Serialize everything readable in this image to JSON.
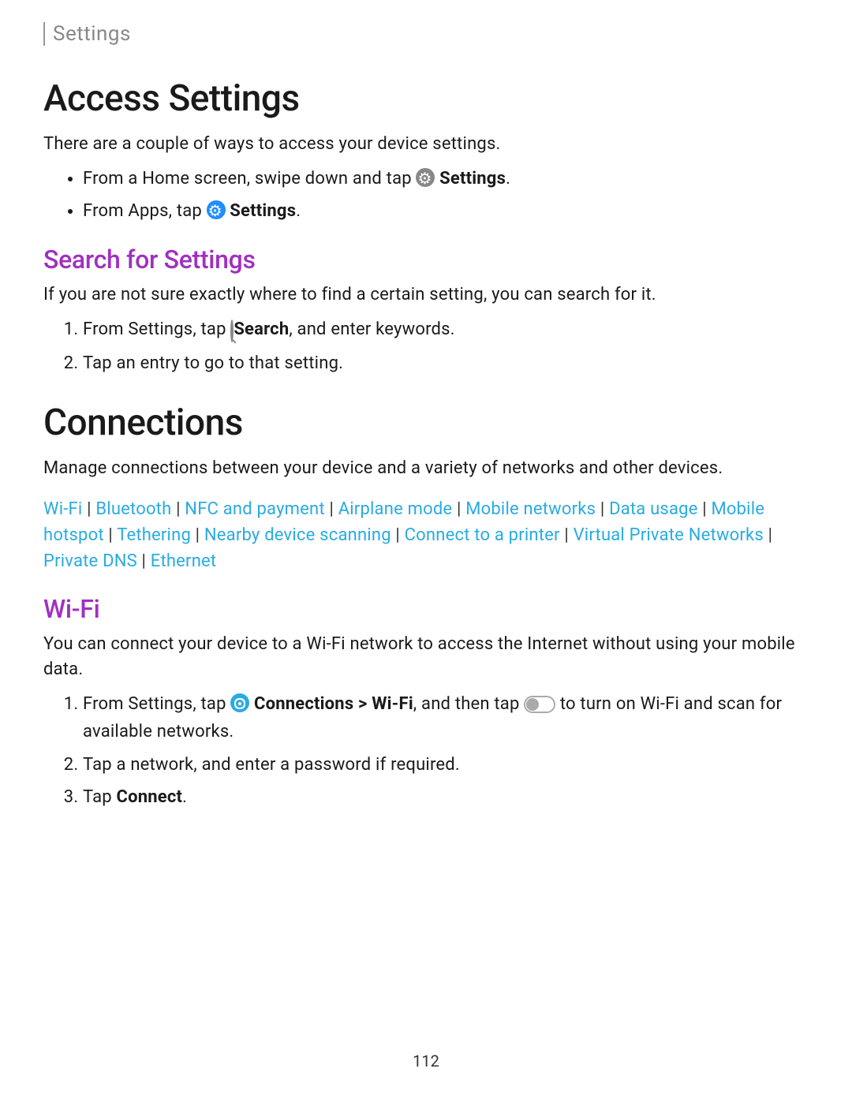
{
  "breadcrumb": "Settings",
  "section1": {
    "title": "Access Settings",
    "intro": "There are a couple of ways to access your device settings.",
    "bullets": {
      "b1_pre": "From a Home screen, swipe down and tap ",
      "b1_bold": "Settings",
      "b1_post": ".",
      "b2_pre": "From Apps, tap ",
      "b2_bold": "Settings",
      "b2_post": "."
    }
  },
  "section2": {
    "title": "Search for Settings",
    "intro": "If you are not sure exactly where to find a certain setting, you can search for it.",
    "steps": {
      "s1_pre": "From Settings, tap ",
      "s1_bold": "Search",
      "s1_post": ", and enter keywords.",
      "s2": "Tap an entry to go to that setting."
    }
  },
  "section3": {
    "title": "Connections",
    "intro": "Manage connections between your device and a variety of networks and other devices.",
    "links": [
      "Wi-Fi",
      "Bluetooth",
      "NFC and payment",
      "Airplane mode",
      "Mobile networks",
      "Data usage",
      "Mobile hotspot",
      "Tethering",
      "Nearby device scanning",
      "Connect to a printer",
      "Virtual Private Networks",
      "Private DNS",
      "Ethernet"
    ]
  },
  "section4": {
    "title": "Wi-Fi",
    "intro": "You can connect your device to a Wi-Fi network to access the Internet without using your mobile data.",
    "steps": {
      "s1_pre": "From Settings, tap ",
      "s1_bold": "Connections > Wi-Fi",
      "s1_mid": ", and then tap ",
      "s1_post": " to turn on Wi-Fi and scan for available networks.",
      "s2": "Tap a network, and enter a password if required.",
      "s3_pre": "Tap ",
      "s3_bold": "Connect",
      "s3_post": "."
    }
  },
  "pageNumber": "112"
}
